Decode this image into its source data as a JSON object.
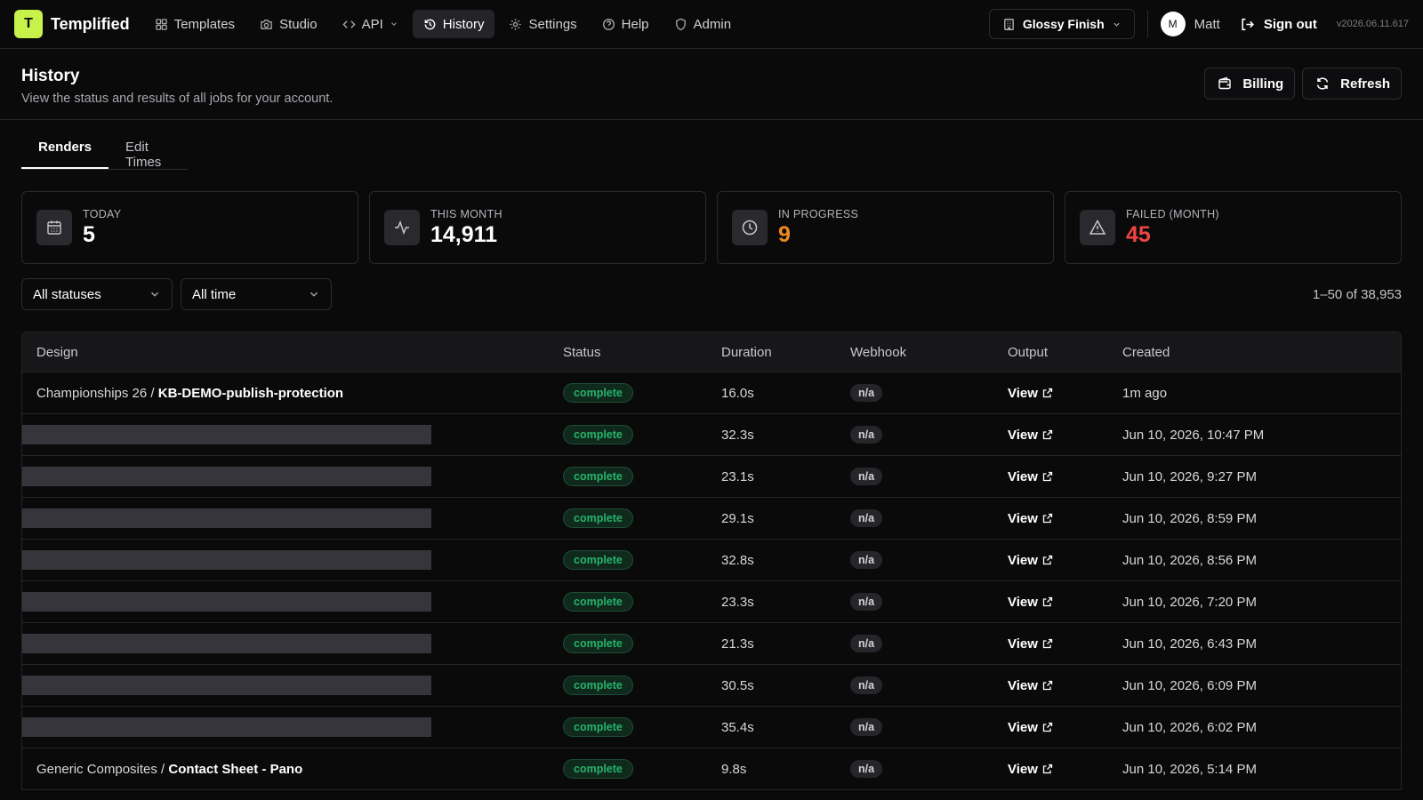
{
  "app": {
    "logo_letter": "T",
    "name": "Templified",
    "version": "v2026.06.11.617"
  },
  "nav": [
    {
      "label": "Templates",
      "icon": "grid-icon"
    },
    {
      "label": "Studio",
      "icon": "camera-icon"
    },
    {
      "label": "API",
      "icon": "code-icon"
    },
    {
      "label": "History",
      "icon": "history-icon",
      "active": true
    },
    {
      "label": "Settings",
      "icon": "gear-icon"
    },
    {
      "label": "Help",
      "icon": "help-icon"
    },
    {
      "label": "Admin",
      "icon": "shield-icon"
    }
  ],
  "workspace": {
    "label": "Glossy Finish"
  },
  "user": {
    "initial": "M",
    "name": "Matt",
    "signout_label": "Sign out"
  },
  "page": {
    "title": "History",
    "subtitle": "View the status and results of all jobs for your account.",
    "billing_label": "Billing",
    "refresh_label": "Refresh"
  },
  "tabs": [
    {
      "label": "Renders",
      "active": true
    },
    {
      "label": "Edit Times"
    }
  ],
  "stats": [
    {
      "label": "TODAY",
      "value": "5",
      "color": "#ffffff",
      "icon": "calendar-icon"
    },
    {
      "label": "THIS MONTH",
      "value": "14,911",
      "color": "#ffffff",
      "icon": "activity-icon"
    },
    {
      "label": "IN PROGRESS",
      "value": "9",
      "color": "#f08a1c",
      "icon": "clock-icon"
    },
    {
      "label": "FAILED (MONTH)",
      "value": "45",
      "color": "#ef4444",
      "icon": "warning-icon"
    }
  ],
  "filters": {
    "status": "All statuses",
    "time": "All time",
    "count": "1–50 of 38,953"
  },
  "table": {
    "headers": {
      "design": "Design",
      "status": "Status",
      "duration": "Duration",
      "webhook": "Webhook",
      "output": "Output",
      "created": "Created"
    },
    "rows": [
      {
        "collection": "Championships 26",
        "design": "KB-DEMO-publish-protection",
        "redacted": false,
        "status": "complete",
        "duration": "16.0s",
        "webhook": "n/a",
        "output": "View",
        "created": "1m ago"
      },
      {
        "redacted": true,
        "status": "complete",
        "duration": "32.3s",
        "webhook": "n/a",
        "output": "View",
        "created": "Jun 10, 2026, 10:47 PM"
      },
      {
        "redacted": true,
        "status": "complete",
        "duration": "23.1s",
        "webhook": "n/a",
        "output": "View",
        "created": "Jun 10, 2026, 9:27 PM"
      },
      {
        "redacted": true,
        "status": "complete",
        "duration": "29.1s",
        "webhook": "n/a",
        "output": "View",
        "created": "Jun 10, 2026, 8:59 PM"
      },
      {
        "redacted": true,
        "status": "complete",
        "duration": "32.8s",
        "webhook": "n/a",
        "output": "View",
        "created": "Jun 10, 2026, 8:56 PM"
      },
      {
        "redacted": true,
        "status": "complete",
        "duration": "23.3s",
        "webhook": "n/a",
        "output": "View",
        "created": "Jun 10, 2026, 7:20 PM"
      },
      {
        "redacted": true,
        "status": "complete",
        "duration": "21.3s",
        "webhook": "n/a",
        "output": "View",
        "created": "Jun 10, 2026, 6:43 PM"
      },
      {
        "redacted": true,
        "status": "complete",
        "duration": "30.5s",
        "webhook": "n/a",
        "output": "View",
        "created": "Jun 10, 2026, 6:09 PM"
      },
      {
        "redacted": true,
        "status": "complete",
        "duration": "35.4s",
        "webhook": "n/a",
        "output": "View",
        "created": "Jun 10, 2026, 6:02 PM"
      },
      {
        "collection": "Generic Composites",
        "design": "Contact Sheet - Pano",
        "redacted": false,
        "status": "complete",
        "duration": "9.8s",
        "webhook": "n/a",
        "output": "View",
        "created": "Jun 10, 2026, 5:14 PM"
      }
    ]
  }
}
